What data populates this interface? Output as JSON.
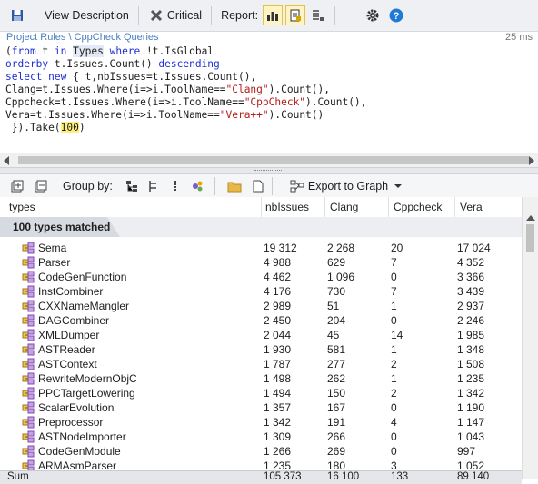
{
  "toolbar": {
    "view_description": "View Description",
    "critical": "Critical",
    "report": "Report:"
  },
  "crumb": {
    "path": "Project Rules \\ CppCheck Queries",
    "timing": "25 ms"
  },
  "query": {
    "l1_a": "(",
    "l1_from": "from",
    "l1_b": " t ",
    "l1_in": "in",
    "l1_c": " ",
    "l1_types": "Types",
    "l1_d": " ",
    "l1_where": "where",
    "l1_e": " !t.IsGlobal",
    "l2_orderby": "orderby",
    "l2_a": " t.Issues.Count() ",
    "l2_desc": "descending",
    "l3_select": "select",
    "l3_a": " ",
    "l3_new": "new",
    "l3_b": " { t,nbIssues=t.Issues.Count(),",
    "l4_a": "Clang=t.Issues.Where(i=>i.ToolName==",
    "l4_str": "\"Clang\"",
    "l4_b": ").Count(),",
    "l5_a": "Cppcheck=t.Issues.Where(i=>i.ToolName==",
    "l5_str": "\"CppCheck\"",
    "l5_b": ").Count(),",
    "l6_a": "Vera=t.Issues.Where(i=>i.ToolName==",
    "l6_str": "\"Vera++\"",
    "l6_b": ").Count()",
    "l7_a": " }).Take(",
    "l7_num": "100",
    "l7_b": ")"
  },
  "resultbar": {
    "group_by": "Group by:",
    "export": "Export to Graph"
  },
  "columns": {
    "types": "types",
    "nbIssues": "nbIssues",
    "clang": "Clang",
    "cppcheck": "Cppcheck",
    "vera": "Vera"
  },
  "group_label": "100 types matched",
  "rows": [
    {
      "name": "Sema",
      "nb": "19 312",
      "clang": "2 268",
      "cpp": "20",
      "vera": "17 024"
    },
    {
      "name": "Parser",
      "nb": "4 988",
      "clang": "629",
      "cpp": "7",
      "vera": "4 352"
    },
    {
      "name": "CodeGenFunction",
      "nb": "4 462",
      "clang": "1 096",
      "cpp": "0",
      "vera": "3 366"
    },
    {
      "name": "InstCombiner",
      "nb": "4 176",
      "clang": "730",
      "cpp": "7",
      "vera": "3 439"
    },
    {
      "name": "CXXNameMangler",
      "nb": "2 989",
      "clang": "51",
      "cpp": "1",
      "vera": "2 937"
    },
    {
      "name": "DAGCombiner",
      "nb": "2 450",
      "clang": "204",
      "cpp": "0",
      "vera": "2 246"
    },
    {
      "name": "XMLDumper",
      "nb": "2 044",
      "clang": "45",
      "cpp": "14",
      "vera": "1 985"
    },
    {
      "name": "ASTReader",
      "nb": "1 930",
      "clang": "581",
      "cpp": "1",
      "vera": "1 348"
    },
    {
      "name": "ASTContext",
      "nb": "1 787",
      "clang": "277",
      "cpp": "2",
      "vera": "1 508"
    },
    {
      "name": "RewriteModernObjC",
      "nb": "1 498",
      "clang": "262",
      "cpp": "1",
      "vera": "1 235"
    },
    {
      "name": "PPCTargetLowering",
      "nb": "1 494",
      "clang": "150",
      "cpp": "2",
      "vera": "1 342"
    },
    {
      "name": "ScalarEvolution",
      "nb": "1 357",
      "clang": "167",
      "cpp": "0",
      "vera": "1 190"
    },
    {
      "name": "Preprocessor",
      "nb": "1 342",
      "clang": "191",
      "cpp": "4",
      "vera": "1 147"
    },
    {
      "name": "ASTNodeImporter",
      "nb": "1 309",
      "clang": "266",
      "cpp": "0",
      "vera": "1 043"
    },
    {
      "name": "CodeGenModule",
      "nb": "1 266",
      "clang": "269",
      "cpp": "0",
      "vera": "997"
    },
    {
      "name": "ARMAsmParser",
      "nb": "1 235",
      "clang": "180",
      "cpp": "3",
      "vera": "1 052"
    }
  ],
  "sum": {
    "label": "Sum",
    "nb": "105 373",
    "clang": "16 100",
    "cpp": "133",
    "vera": "89 140"
  }
}
